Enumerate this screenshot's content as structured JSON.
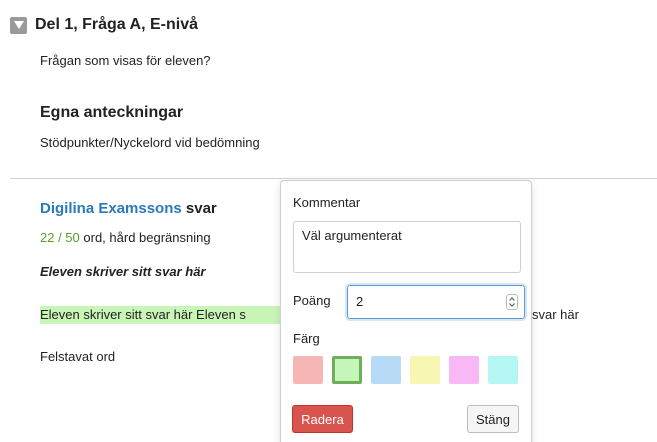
{
  "section": {
    "title": "Del 1, Fråga A, E-nivå",
    "question": "Frågan som visas för eleven?"
  },
  "notes": {
    "heading": "Egna anteckningar",
    "text": "Stödpunkter/Nyckelord vid bedömning"
  },
  "answer": {
    "brand": "Digilina Examssons",
    "title_suffix": "svar",
    "word_count": "22 / 50",
    "word_count_suffix": "ord, hård begränsning",
    "italic_text": "Eleven skriver sitt svar här",
    "highlighted": "Eleven skriver sitt svar här Eleven s",
    "tail": "svar här",
    "misspelled": "Felstavat ord"
  },
  "popover": {
    "comment_label": "Kommentar",
    "comment_value": "Väl argumenterat",
    "points_label": "Poäng",
    "points_value": "2",
    "color_label": "Färg",
    "colors": [
      "#f7b6b6",
      "#c5f5b8",
      "#b7daf7",
      "#f7f6b2",
      "#f8b8f6",
      "#b6f6f3"
    ],
    "selected_color_index": 1,
    "delete_label": "Radera",
    "close_label": "Stäng"
  },
  "icons": {
    "toggle": "triangle-down-icon",
    "spinner": "spinner-arrows-icon"
  }
}
